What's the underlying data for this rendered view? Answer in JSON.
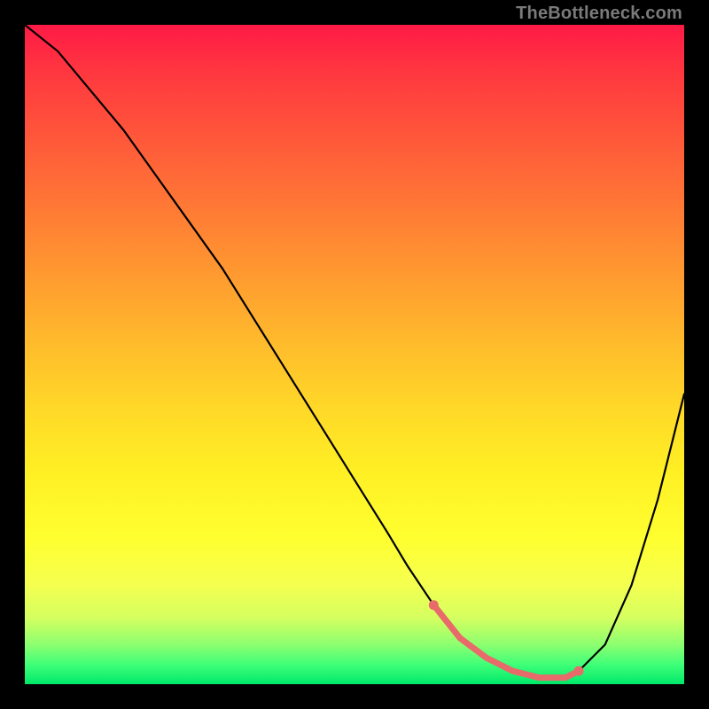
{
  "watermark": "TheBottleneck.com",
  "colors": {
    "background": "#000000",
    "gradient_top": "#ff1a46",
    "gradient_bottom": "#00e86a",
    "curve": "#000000",
    "accent": "#e86a6a"
  },
  "chart_data": {
    "type": "line",
    "title": "",
    "xlabel": "",
    "ylabel": "",
    "xlim": [
      0,
      100
    ],
    "ylim": [
      0,
      100
    ],
    "grid": false,
    "legend": false,
    "series": [
      {
        "name": "bottleneck-curve",
        "x": [
          0,
          5,
          10,
          15,
          20,
          25,
          30,
          35,
          40,
          45,
          50,
          55,
          58,
          62,
          66,
          70,
          74,
          78,
          82,
          84,
          88,
          92,
          96,
          100
        ],
        "y": [
          100,
          96,
          90,
          84,
          77,
          70,
          63,
          55,
          47,
          39,
          31,
          23,
          18,
          12,
          7,
          4,
          2,
          1,
          1,
          2,
          6,
          15,
          28,
          44
        ]
      }
    ],
    "accent_region": {
      "name": "optimal-band",
      "x": [
        62,
        66,
        70,
        74,
        78,
        82,
        84
      ],
      "y": [
        12,
        7,
        4,
        2,
        1,
        1,
        2
      ],
      "dots_x": [
        62,
        84
      ],
      "dots_y": [
        12,
        2
      ]
    }
  }
}
